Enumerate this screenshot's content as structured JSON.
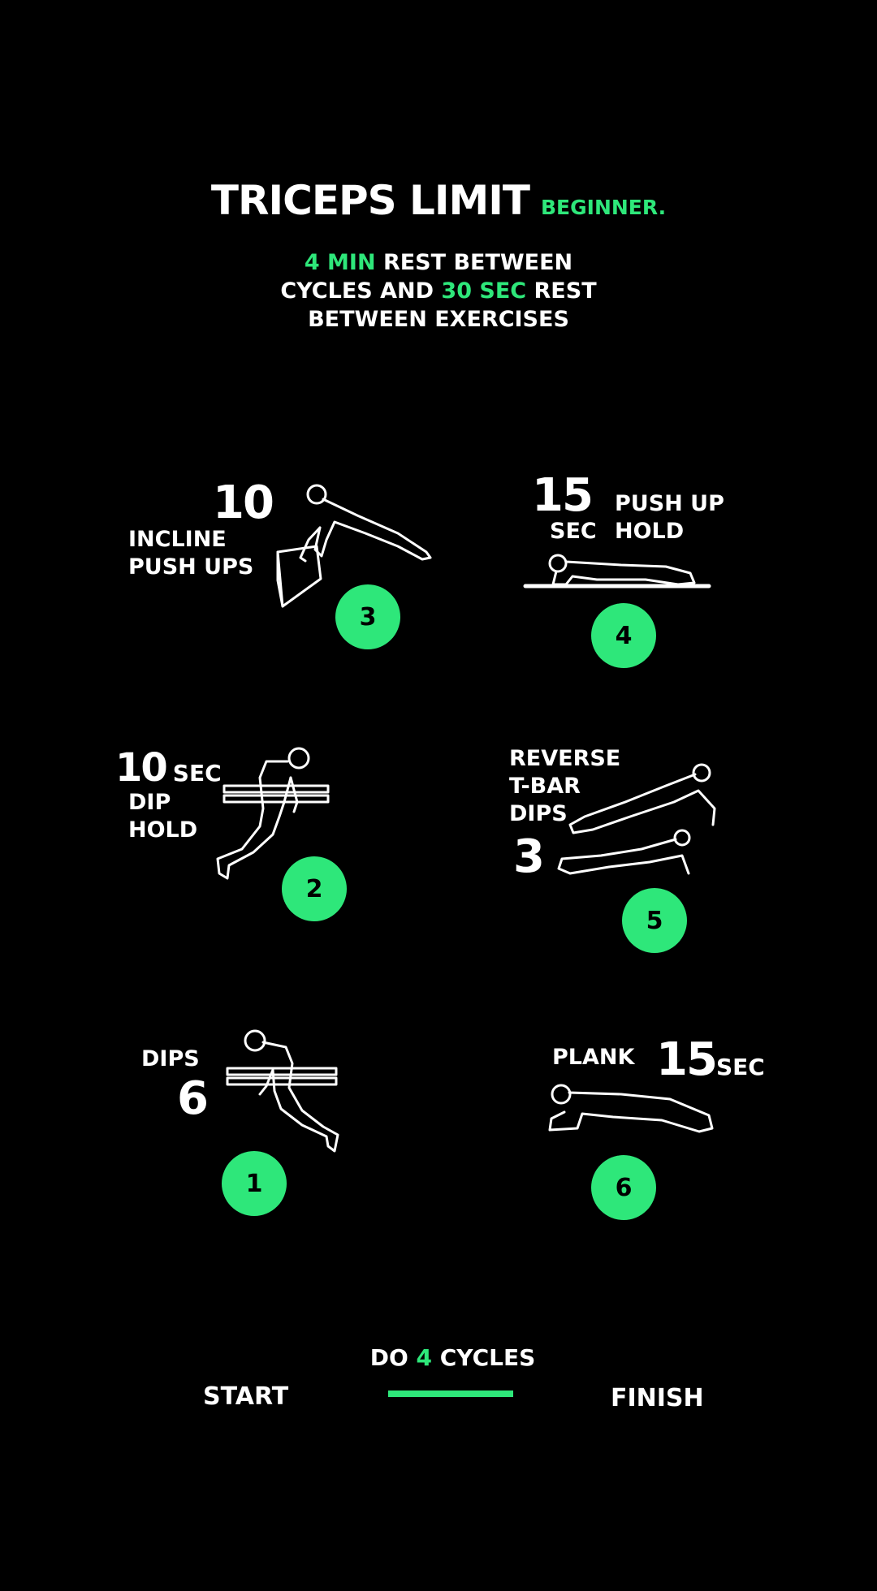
{
  "header": {
    "title": "TRICEPS LIMIT",
    "level": "BEGINNER.",
    "rest_info": {
      "part1_highlight": "4 MIN",
      "part2": " REST BETWEEN",
      "part3": "CYCLES AND ",
      "part4_highlight": "30 SEC",
      "part5": " REST",
      "part6": "BETWEEN EXERCISES"
    }
  },
  "exercises": [
    {
      "step": "1",
      "name": "DIPS",
      "amount": "6",
      "unit": ""
    },
    {
      "step": "2",
      "name_line1": "DIP",
      "name_line2": "HOLD",
      "amount": "10",
      "unit": "SEC"
    },
    {
      "step": "3",
      "name_line1": "INCLINE",
      "name_line2": "PUSH UPS",
      "amount": "10",
      "unit": ""
    },
    {
      "step": "4",
      "name_line1": "PUSH UP",
      "name_line2": "HOLD",
      "amount": "15",
      "unit": "SEC"
    },
    {
      "step": "5",
      "name_line1": "REVERSE",
      "name_line2": "T-BAR",
      "name_line3": "DIPS",
      "amount": "3",
      "unit": ""
    },
    {
      "step": "6",
      "name": "PLANK",
      "amount": "15",
      "unit": "SEC"
    }
  ],
  "footer": {
    "cycles_prefix": "DO ",
    "cycles_count": "4",
    "cycles_suffix": " CYCLES",
    "start": "START",
    "finish": "FINISH"
  },
  "colors": {
    "background": "#000000",
    "accent": "#2ee77a",
    "text": "#ffffff"
  },
  "icons": [
    "incline-push-up-figure",
    "push-up-hold-figure",
    "dip-hold-figure",
    "reverse-t-bar-dips-figure",
    "dips-figure",
    "plank-figure"
  ]
}
